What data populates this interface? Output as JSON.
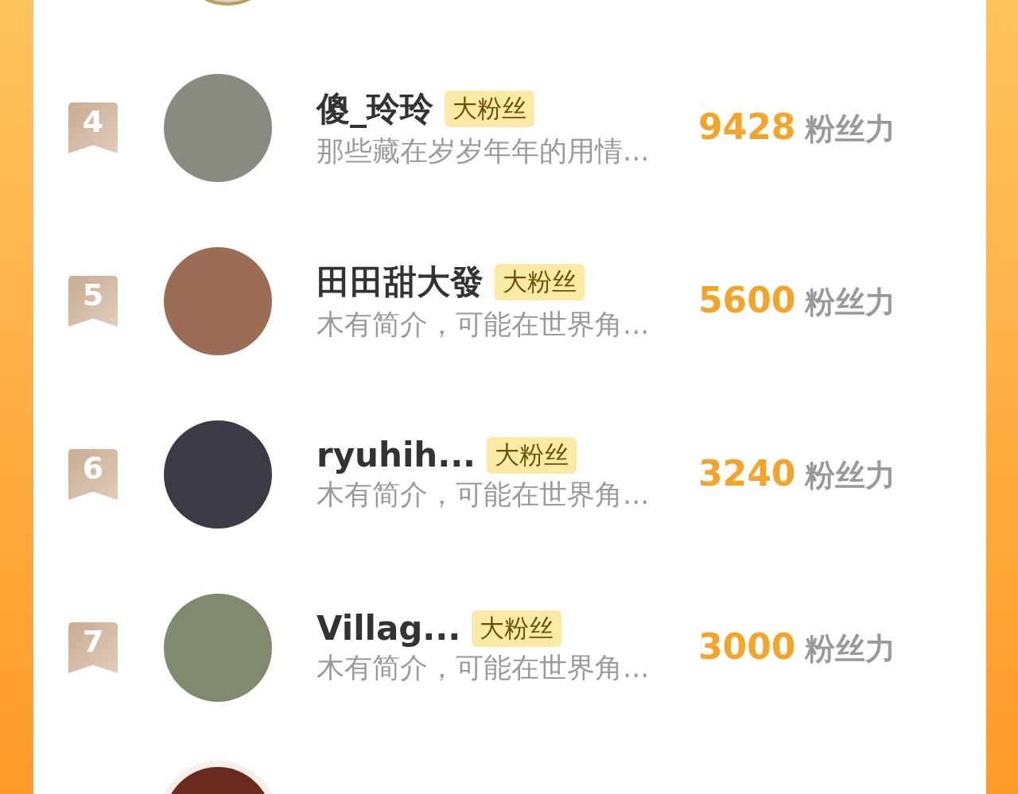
{
  "rows": [
    {
      "rank": "4",
      "name": "傻_玲玲",
      "badge": "大粉丝",
      "intro": "那些藏在岁岁年年的用情...",
      "score": "9428",
      "score_unit": "粉丝力"
    },
    {
      "rank": "5",
      "name": "田田甜大發",
      "badge": "大粉丝",
      "intro": "木有简介，可能在世界角...",
      "score": "5600",
      "score_unit": "粉丝力"
    },
    {
      "rank": "6",
      "name": "ryuhih...",
      "badge": "大粉丝",
      "intro": "木有简介，可能在世界角...",
      "score": "3240",
      "score_unit": "粉丝力"
    },
    {
      "rank": "7",
      "name": "Villag...",
      "badge": "大粉丝",
      "intro": "木有简介，可能在世界角...",
      "score": "3000",
      "score_unit": "粉丝力"
    }
  ]
}
